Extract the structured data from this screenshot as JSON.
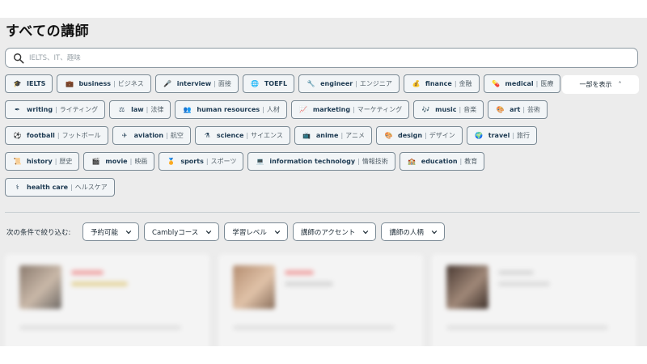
{
  "title": "すべての講師",
  "search": {
    "placeholder": "IELTS、IT、趣味",
    "value": ""
  },
  "tags": [
    [
      {
        "en": "IELTS",
        "jp": "",
        "icon": "graduation-cap-icon",
        "glyph": "🎓"
      },
      {
        "en": "business",
        "jp": "ビジネス",
        "icon": "briefcase-icon",
        "glyph": "💼"
      },
      {
        "en": "interview",
        "jp": "面接",
        "icon": "microphone-icon",
        "glyph": "🎤"
      },
      {
        "en": "TOEFL",
        "jp": "",
        "icon": "globe-icon",
        "glyph": "🌐"
      },
      {
        "en": "engineer",
        "jp": "エンジニア",
        "icon": "wrench-icon",
        "glyph": "🔧"
      },
      {
        "en": "finance",
        "jp": "金融",
        "icon": "money-bag-icon",
        "glyph": "💰"
      },
      {
        "en": "medical",
        "jp": "医療",
        "icon": "pill-icon",
        "glyph": "💊"
      }
    ],
    [
      {
        "en": "writing",
        "jp": "ライティング",
        "icon": "pen-icon",
        "glyph": "✒"
      },
      {
        "en": "law",
        "jp": "法律",
        "icon": "scales-icon",
        "glyph": "⚖"
      },
      {
        "en": "human resources",
        "jp": "人材",
        "icon": "people-icon",
        "glyph": "👥"
      },
      {
        "en": "marketing",
        "jp": "マーケティング",
        "icon": "chart-icon",
        "glyph": "📈"
      },
      {
        "en": "music",
        "jp": "音楽",
        "icon": "music-note-icon",
        "glyph": "🎶"
      },
      {
        "en": "art",
        "jp": "芸術",
        "icon": "palette-icon",
        "glyph": "🎨"
      }
    ],
    [
      {
        "en": "football",
        "jp": "フットボール",
        "icon": "football-icon",
        "glyph": "⚽"
      },
      {
        "en": "aviation",
        "jp": "航空",
        "icon": "airplane-icon",
        "glyph": "✈"
      },
      {
        "en": "science",
        "jp": "サイエンス",
        "icon": "flask-icon",
        "glyph": "⚗"
      },
      {
        "en": "anime",
        "jp": "アニメ",
        "icon": "tv-icon",
        "glyph": "📺"
      },
      {
        "en": "design",
        "jp": "デザイン",
        "icon": "palette-icon",
        "glyph": "🎨"
      },
      {
        "en": "travel",
        "jp": "旅行",
        "icon": "globe-icon",
        "glyph": "🌍"
      }
    ],
    [
      {
        "en": "history",
        "jp": "歴史",
        "icon": "scroll-icon",
        "glyph": "📜"
      },
      {
        "en": "movie",
        "jp": "映画",
        "icon": "clapperboard-icon",
        "glyph": "🎬"
      },
      {
        "en": "sports",
        "jp": "スポーツ",
        "icon": "medal-icon",
        "glyph": "🏅"
      },
      {
        "en": "information technology",
        "jp": "情報技術",
        "icon": "computer-icon",
        "glyph": "💻"
      },
      {
        "en": "education",
        "jp": "教育",
        "icon": "school-icon",
        "glyph": "🏫"
      }
    ],
    [
      {
        "en": "health care",
        "jp": "ヘルスケア",
        "icon": "stethoscope-icon",
        "glyph": "⚕"
      }
    ]
  ],
  "show_less_label": "一部を表示",
  "filter_label": "次の条件で絞り込む:",
  "filters": [
    {
      "label": "予約可能"
    },
    {
      "label": "Camblyコース"
    },
    {
      "label": "学習レベル"
    },
    {
      "label": "講師のアクセント"
    },
    {
      "label": "講師の人柄"
    }
  ],
  "colors": {
    "background": "#ececec",
    "tag_border": "#7b8a95",
    "text": "#1d2b36"
  }
}
